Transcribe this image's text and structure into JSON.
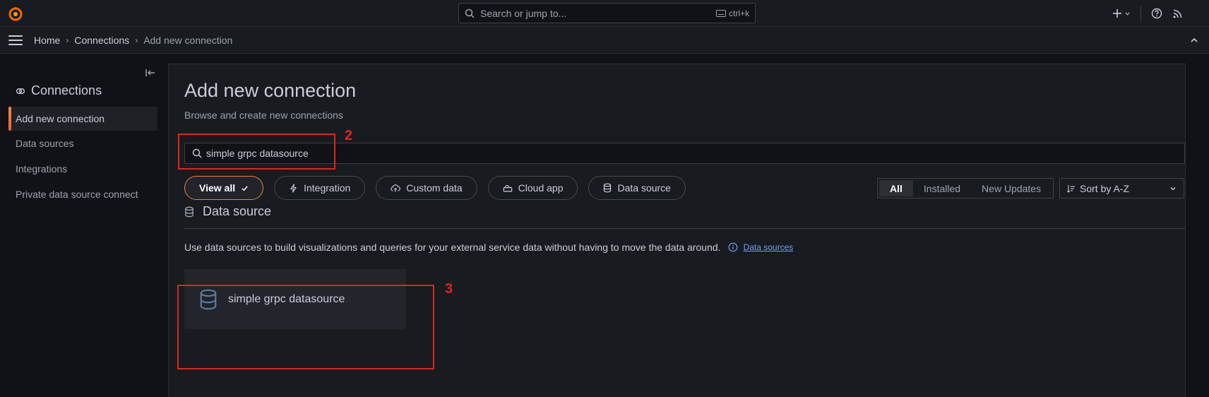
{
  "topbar": {
    "search_placeholder": "Search or jump to...",
    "search_shortcut": "ctrl+k"
  },
  "breadcrumb": {
    "items": [
      "Home",
      "Connections",
      "Add new connection"
    ]
  },
  "sidebar": {
    "title": "Connections",
    "items": [
      {
        "label": "Add new connection",
        "active": true
      },
      {
        "label": "Data sources",
        "active": false
      },
      {
        "label": "Integrations",
        "active": false
      },
      {
        "label": "Private data source connect",
        "active": false
      }
    ]
  },
  "main": {
    "title": "Add new connection",
    "subtitle": "Browse and create new connections",
    "search_value": "simple grpc datasource",
    "chips": [
      {
        "label": "View all",
        "active": true
      },
      {
        "label": "Integration",
        "active": false
      },
      {
        "label": "Custom data",
        "active": false
      },
      {
        "label": "Cloud app",
        "active": false
      },
      {
        "label": "Data source",
        "active": false
      }
    ],
    "segment": [
      "All",
      "Installed",
      "New Updates"
    ],
    "sort_label": "Sort by A-Z",
    "section": {
      "title": "Data source",
      "description": "Use data sources to build visualizations and queries for your external service data without having to move the data around.",
      "link": "Data sources"
    },
    "card": {
      "label": "simple grpc datasource"
    }
  },
  "annotations": {
    "first": "2",
    "second": "3"
  },
  "colors": {
    "accent": "#f57c3d",
    "annotation": "#e1251b",
    "link": "#6e9fff"
  }
}
